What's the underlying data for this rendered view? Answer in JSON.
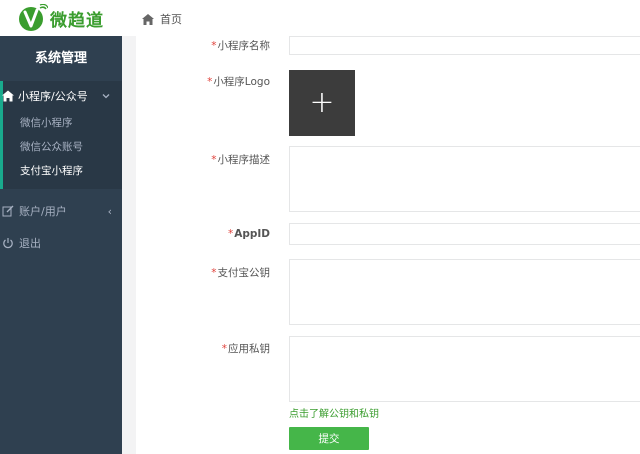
{
  "brand": {
    "name": "微趋道",
    "color": "#3a9d2e"
  },
  "breadcrumb": {
    "home_icon": "home-icon",
    "label": "首页"
  },
  "sidebar": {
    "title": "系统管理",
    "group": {
      "label": "小程序/公众号",
      "icon": "home-icon",
      "items": [
        {
          "label": "微信小程序",
          "active": false
        },
        {
          "label": "微信公众账号",
          "active": false
        },
        {
          "label": "支付宝小程序",
          "active": true
        }
      ]
    },
    "items": [
      {
        "label": "账户/用户",
        "icon": "edit-icon"
      },
      {
        "label": "退出",
        "icon": "power-icon"
      }
    ],
    "colors": {
      "bg": "#2f4050",
      "active_bg": "#293846",
      "accent": "#19aa8d"
    }
  },
  "form": {
    "fields": [
      {
        "label": "小程序名称",
        "required": true,
        "value": ""
      },
      {
        "label": "小程序Logo",
        "required": true,
        "upload_icon": "plus-icon"
      },
      {
        "label": "小程序描述",
        "required": true,
        "value": ""
      },
      {
        "label": "AppID",
        "required": true,
        "value": ""
      },
      {
        "label": "支付宝公钥",
        "required": true,
        "value": ""
      },
      {
        "label": "应用私钥",
        "required": true,
        "value": ""
      }
    ],
    "help_link": "点击了解公钥和私钥",
    "submit_label": "提交",
    "submit_color": "#45b649",
    "required_mark": "*"
  }
}
